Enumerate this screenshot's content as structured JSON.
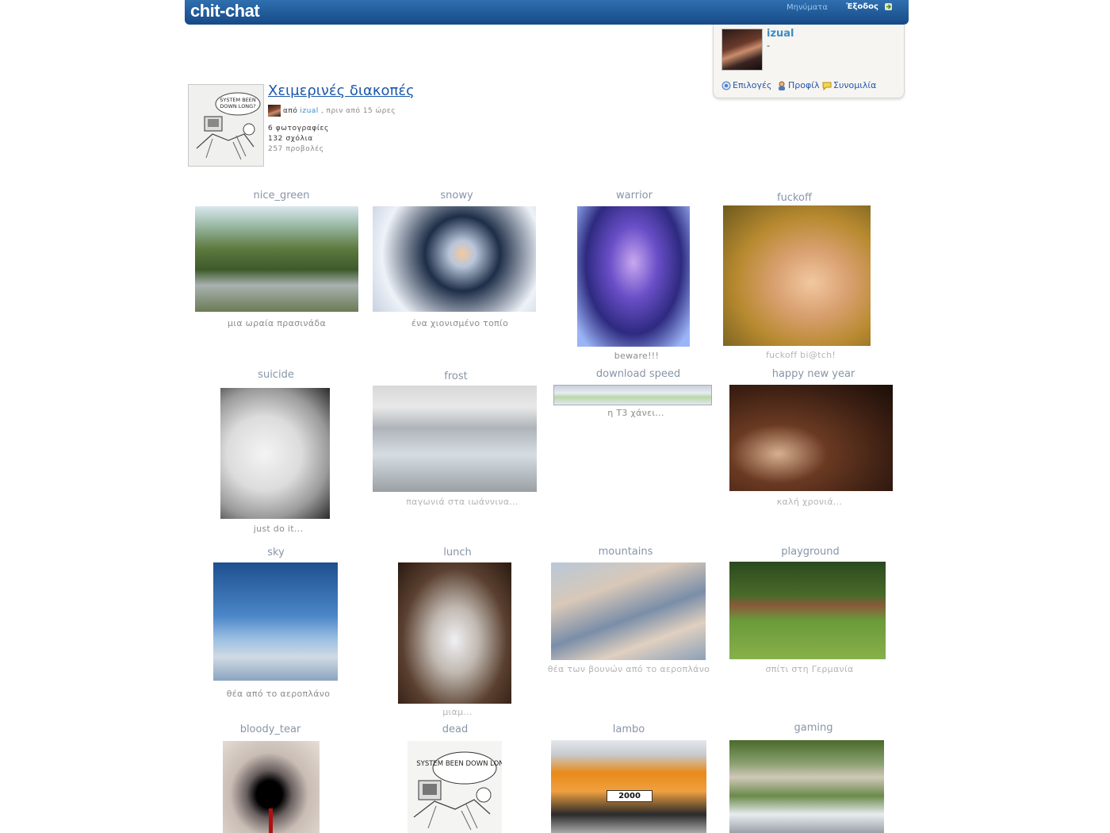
{
  "header": {
    "logo": "chit-chat",
    "messages_label": "Μηνύματα",
    "logout_label": "Έξοδος"
  },
  "user_panel": {
    "username": "izual",
    "status": "-",
    "links": [
      {
        "label": "Επιλογές",
        "icon": "options-icon"
      },
      {
        "label": "Προφίλ",
        "icon": "profile-icon"
      },
      {
        "label": "Συνομιλία",
        "icon": "chat-bubble-icon"
      }
    ]
  },
  "album": {
    "title": "Χειμερινές διακοπές",
    "by_label": "από",
    "owner": "izual",
    "time_ago": ", πριν από 15 ώρες",
    "photos_count": "6 φωτογραφίες",
    "comments_count": "132 σχόλια",
    "views_count": "257 προβολές",
    "cover_text": "SYSTEM BEEN DOWN LONG?"
  },
  "photos": [
    {
      "title": "nice_green",
      "caption": "μια ωραία πρασινάδα"
    },
    {
      "title": "snowy",
      "caption": "ένα χιονισμένο τοπίο"
    },
    {
      "title": "warrior",
      "caption": "beware!!!"
    },
    {
      "title": "fuckoff",
      "caption": "fuckoff bi@tch!"
    },
    {
      "title": "suicide",
      "caption": "just do it..."
    },
    {
      "title": "frost",
      "caption": "παγωνιά στα ιωάννινα..."
    },
    {
      "title": "download speed",
      "caption": "η Τ3 χάνει..."
    },
    {
      "title": "happy new year",
      "caption": "καλή χρονιά..."
    },
    {
      "title": "sky",
      "caption": "θέα από το αεροπλάνο"
    },
    {
      "title": "lunch",
      "caption": "μιαμ..."
    },
    {
      "title": "mountains",
      "caption": "θέα των βουνών από το αεροπλάνο"
    },
    {
      "title": "playground",
      "caption": "σπίτι στη Γερμανία"
    },
    {
      "title": "bloody_tear",
      "caption": ""
    },
    {
      "title": "dead",
      "caption": "",
      "thumb_text": "SYSTEM BEEN DOWN LONG?"
    },
    {
      "title": "lambo",
      "caption": "",
      "thumb_text": "2000"
    },
    {
      "title": "gaming",
      "caption": ""
    }
  ]
}
